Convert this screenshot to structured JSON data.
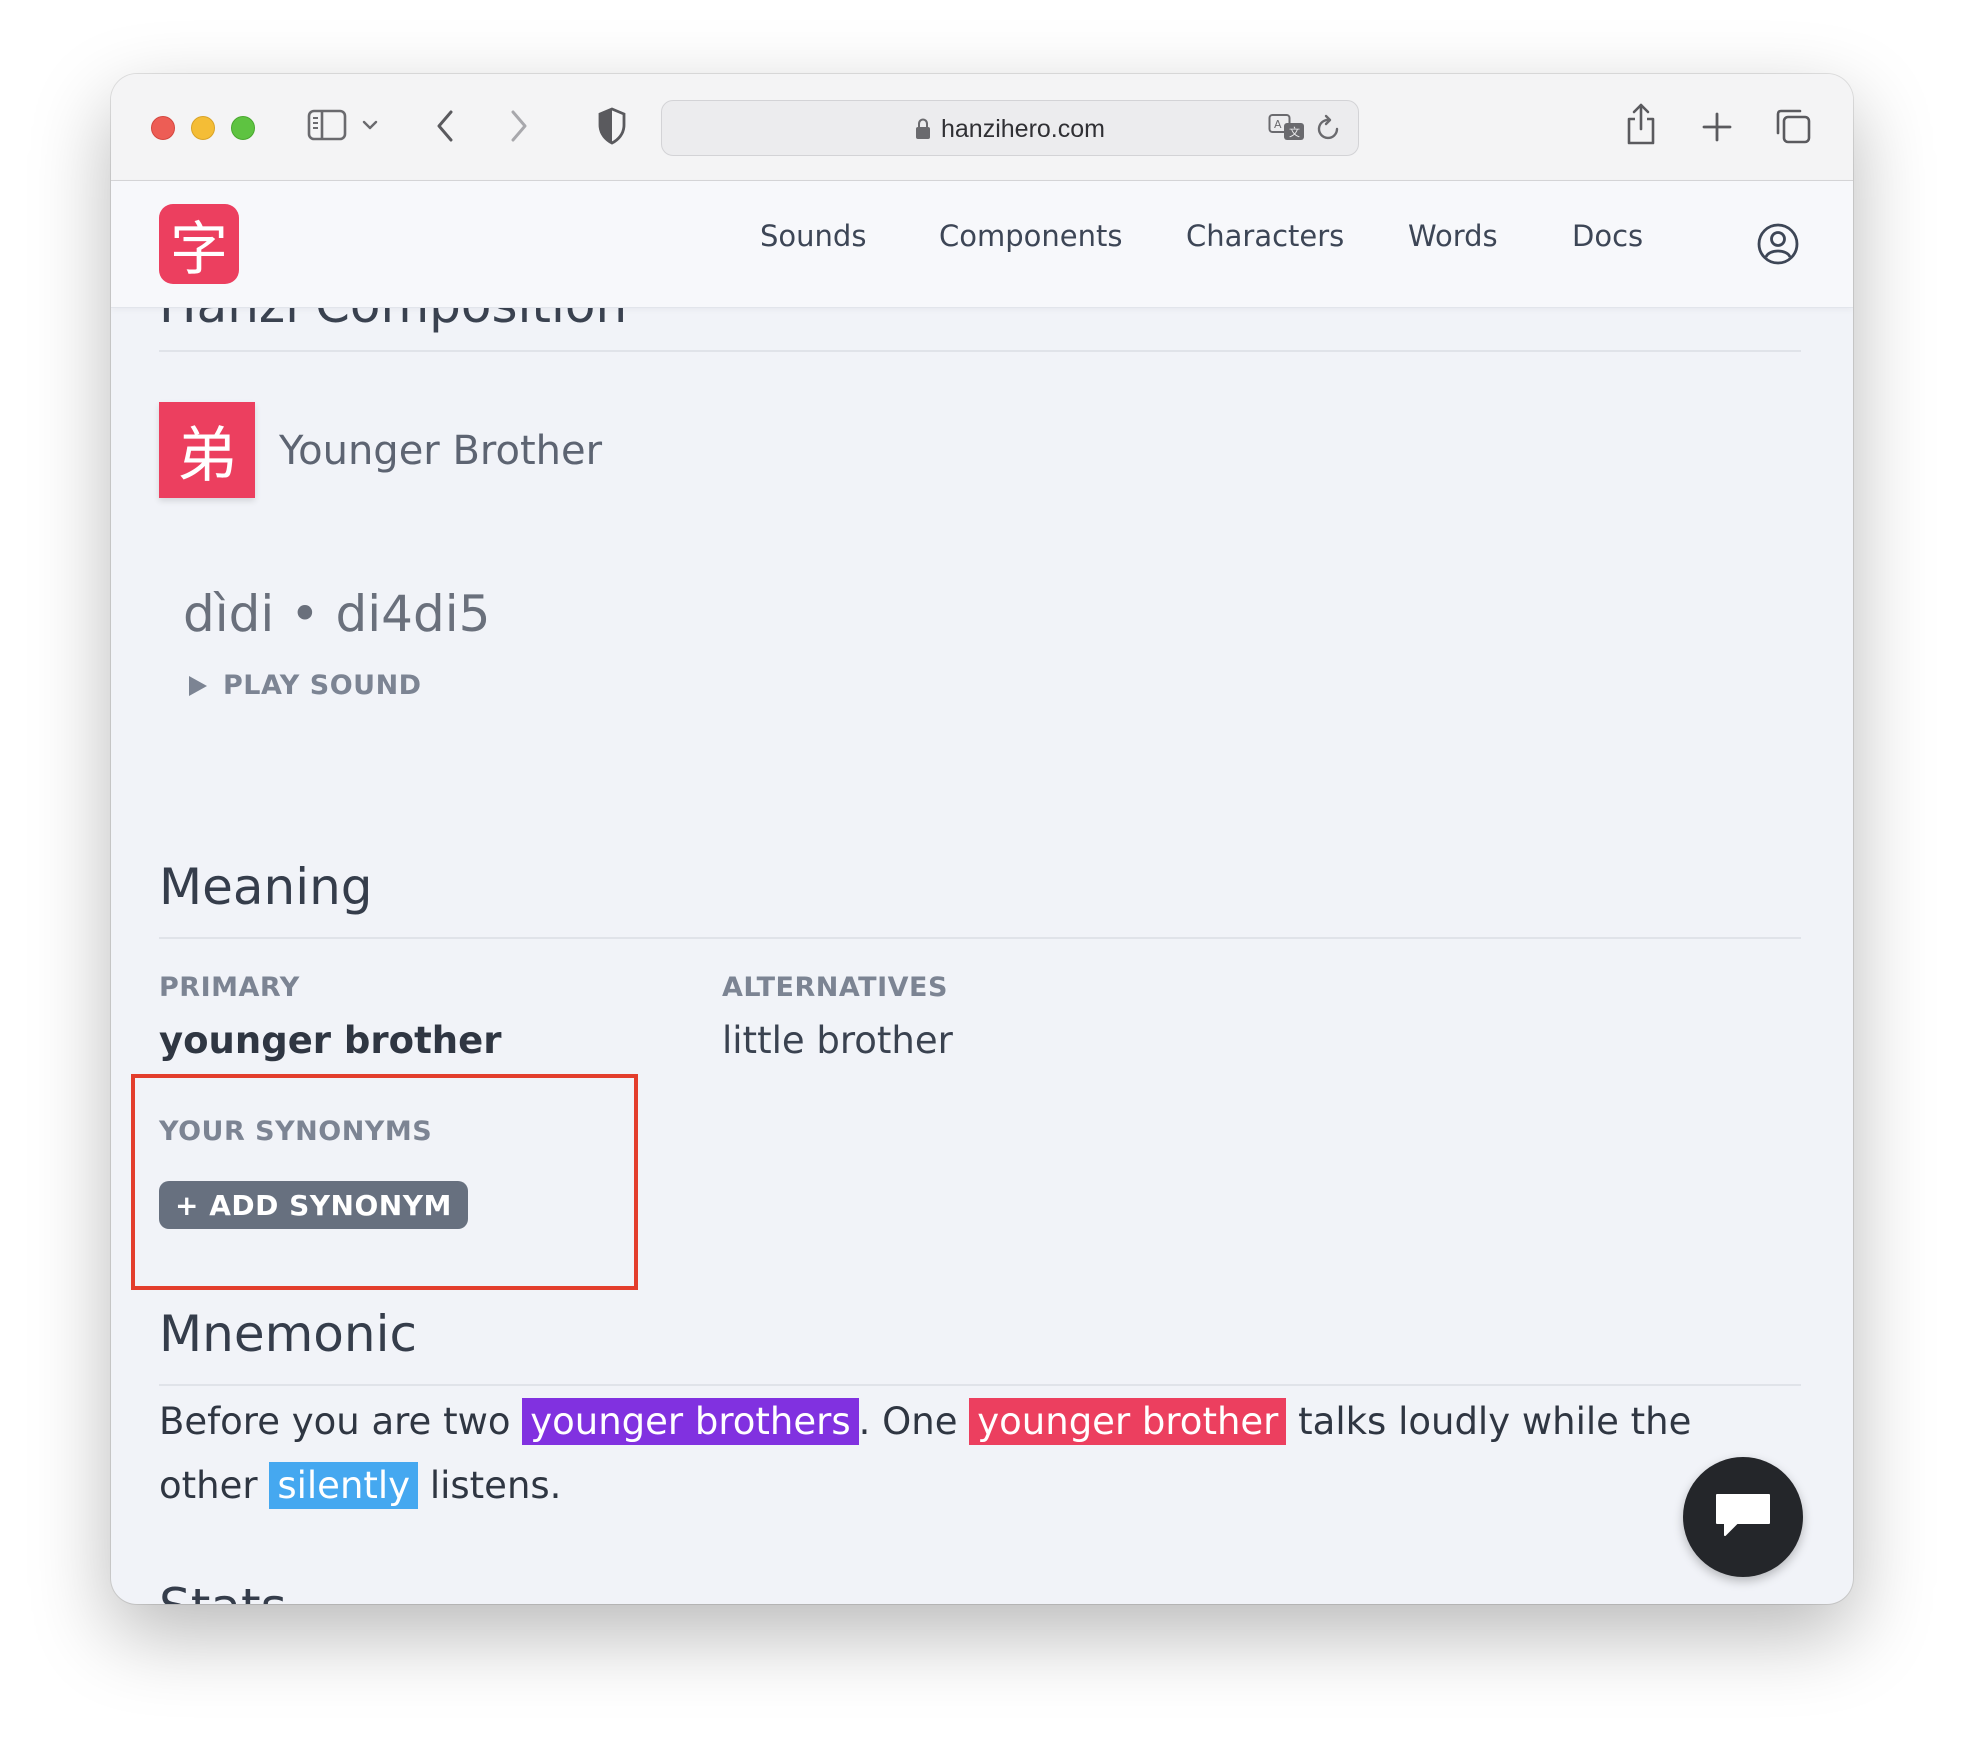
{
  "browser": {
    "url": "hanzihero.com"
  },
  "nav": {
    "items": [
      "Sounds",
      "Components",
      "Characters",
      "Words",
      "Docs"
    ]
  },
  "logo_char": "字",
  "section_partial_title": "Hanzi Composition",
  "character": {
    "glyph": "弟",
    "name": "Younger Brother",
    "pinyin": "dìdi • di4di5",
    "play_sound": "PLAY SOUND"
  },
  "meaning": {
    "title": "Meaning",
    "primary_label": "PRIMARY",
    "primary_value": "younger brother",
    "alternatives_label": "ALTERNATIVES",
    "alternatives_value": "little brother",
    "synonyms_label": "YOUR SYNONYMS",
    "add_synonym": "+ ADD SYNONYM"
  },
  "mnemonic": {
    "title": "Mnemonic",
    "t1": "Before you are two ",
    "h1": "younger brothers",
    "t2": ". One ",
    "h2": "younger brother",
    "t3": " talks loudly while the other ",
    "h3": "silently",
    "t4": " listens."
  },
  "stats": {
    "title": "Stats"
  },
  "colors": {
    "brand": "#ec3f5f",
    "highlight_purple": "#8131e0",
    "highlight_blue": "#45a8f0",
    "annotation_box": "#e33d2c"
  }
}
